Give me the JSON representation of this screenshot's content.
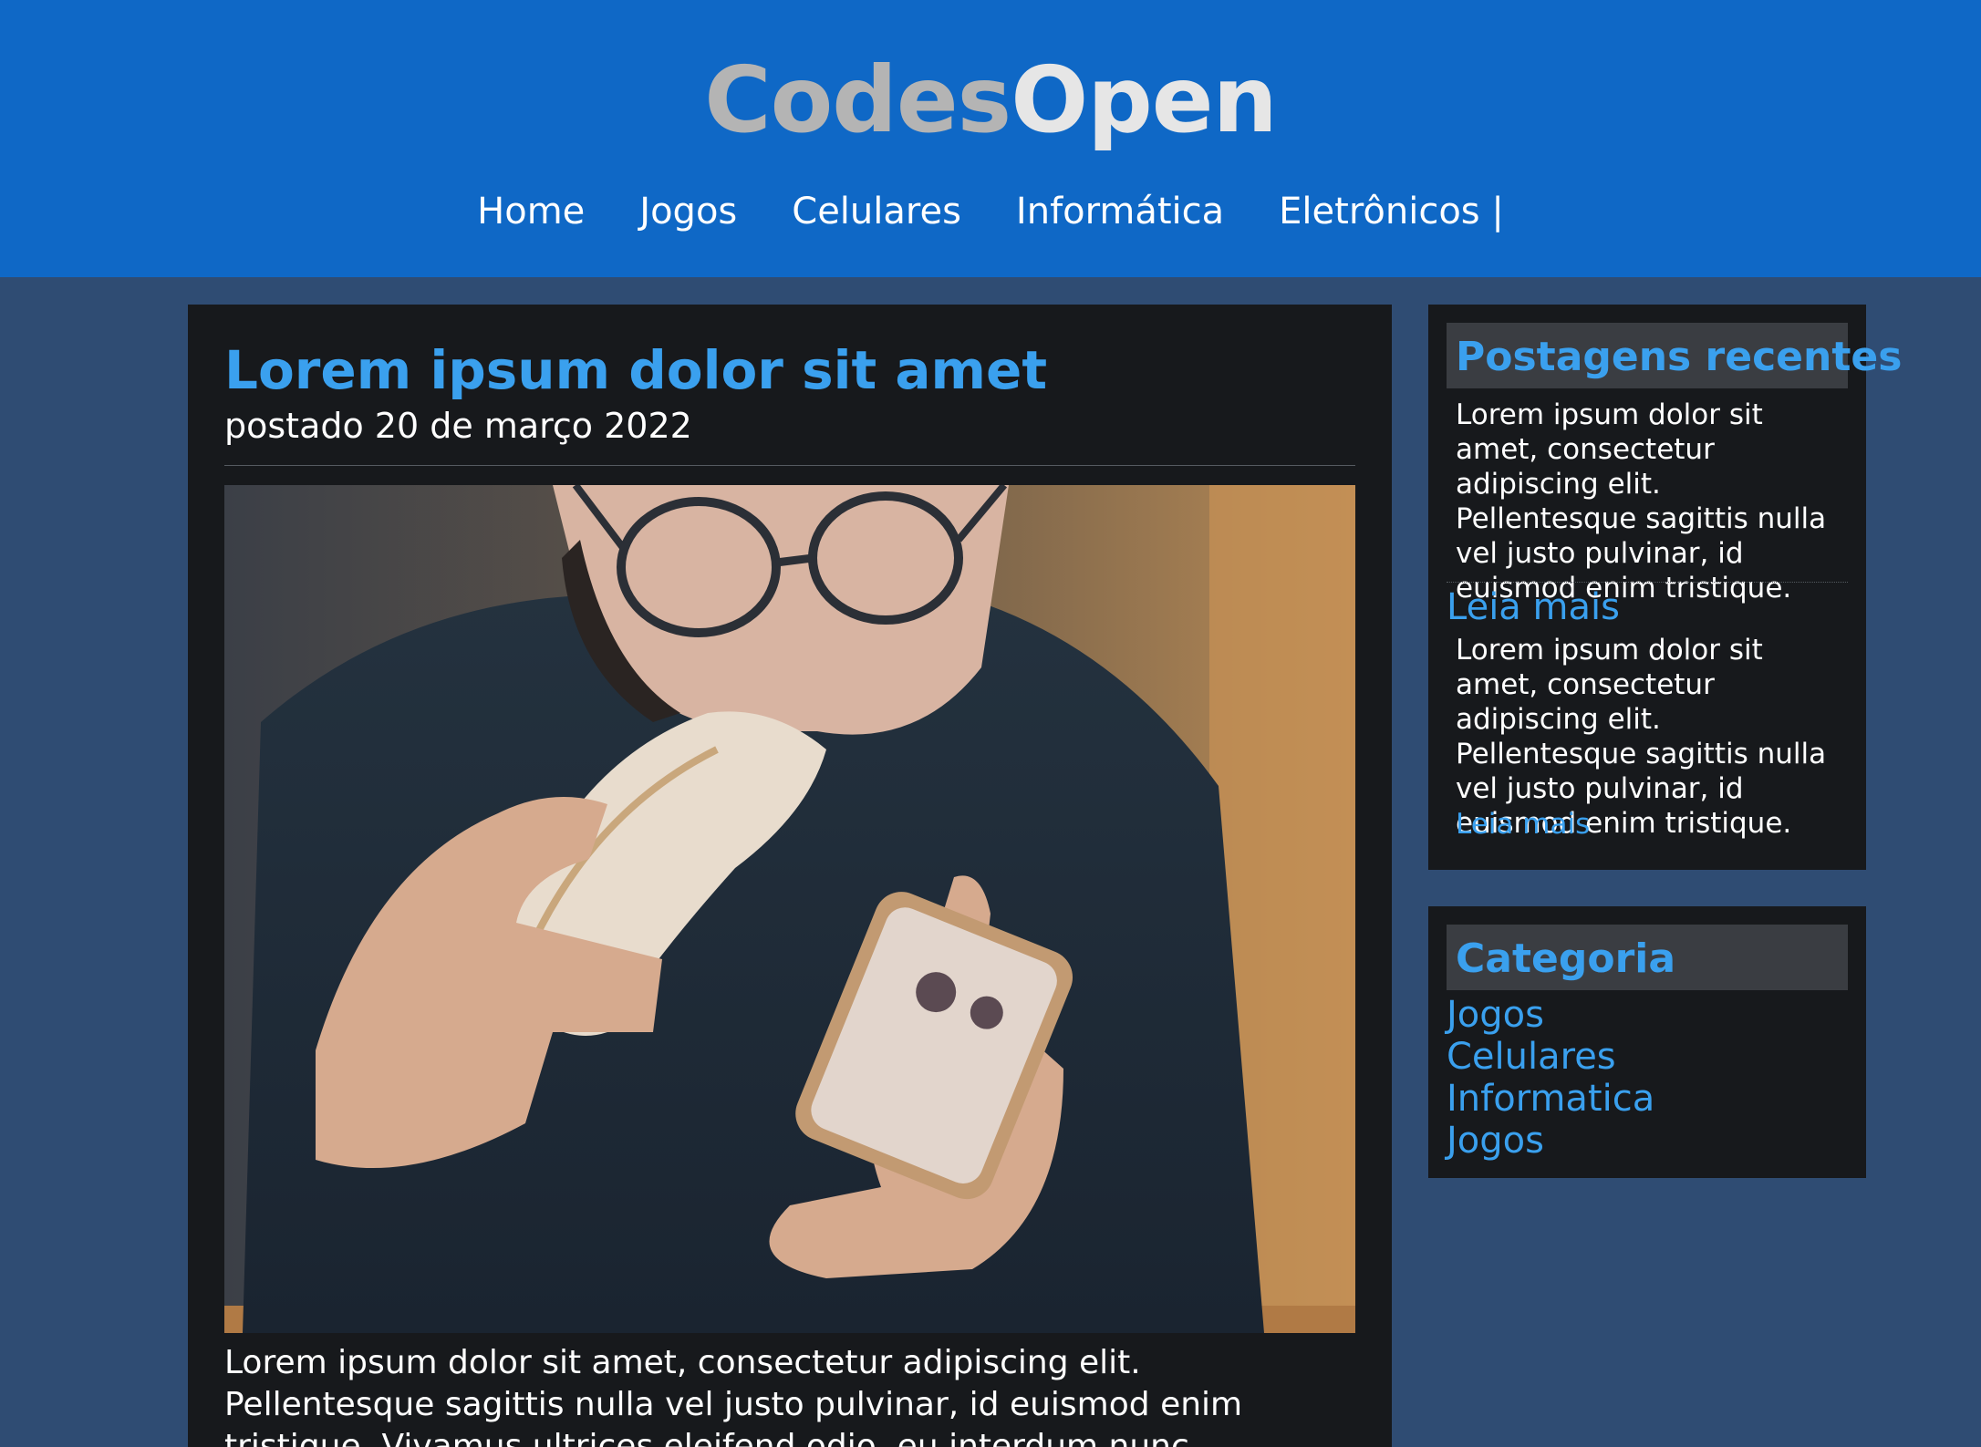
{
  "header": {
    "logo_part1": "Codes",
    "logo_part2": "Open",
    "nav": [
      "Home",
      "Jogos",
      "Celulares",
      "Informática",
      "Eletrônicos |"
    ]
  },
  "article": {
    "title": "Lorem ipsum dolor sit amet",
    "date": "postado 20 de março 2022",
    "body": "Lorem ipsum dolor sit amet, consectetur adipiscing elit. Pellentesque sagittis nulla vel justo pulvinar, id euismod enim tristique. Vivamus ultrices eleifend odio, eu interdum nunc dignissim"
  },
  "sidebar": {
    "recent_title": "Postagens recentes",
    "recent_text_1": "Lorem ipsum dolor sit amet, consectetur adipiscing elit. Pellentesque sagittis nulla vel justo pulvinar, id euismod enim tristique.",
    "read_more_1": "Leia mais",
    "recent_text_2": "Lorem ipsum dolor sit amet, consectetur adipiscing elit. Pellentesque sagittis nulla vel justo pulvinar, id euismod enim tristique.",
    "read_more_2": "Leia mais",
    "category_title": "Categoria",
    "categories": [
      "Jogos",
      "Celulares",
      "Informatica",
      "Jogos"
    ]
  },
  "colors": {
    "header_bg": "#0f68c6",
    "page_bg": "#2f4c73",
    "panel_bg": "#17191c",
    "accent": "#3aa0ee"
  }
}
